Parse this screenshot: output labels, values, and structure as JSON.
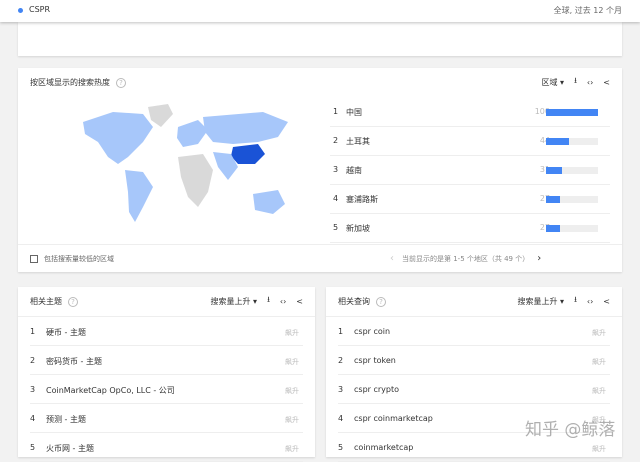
{
  "topbar": {
    "term": "CSPR",
    "scope": "全球, 过去 12 个月"
  },
  "region": {
    "title": "按区域显示的搜索热度",
    "help": "?",
    "dropdown": "区域 ▾",
    "download": "⭳",
    "embed": "‹›",
    "share": "<",
    "rows": [
      {
        "rank": "1",
        "name": "中国",
        "value": "100",
        "pct": 100
      },
      {
        "rank": "2",
        "name": "土耳其",
        "value": "44",
        "pct": 44
      },
      {
        "rank": "3",
        "name": "越南",
        "value": "31",
        "pct": 31
      },
      {
        "rank": "4",
        "name": "塞浦路斯",
        "value": "27",
        "pct": 27
      },
      {
        "rank": "5",
        "name": "新加坡",
        "value": "27",
        "pct": 27
      }
    ],
    "checkbox_label": "包括搜索量较低的区域",
    "pagination": "当前显示的是第 1-5 个地区（共 49 个）",
    "prev": "‹",
    "next": "›",
    "colors": {
      "accent": "#4285f4",
      "china": "#1a53d6",
      "mid": "#a7c7fa",
      "none": "#d9d9d9"
    }
  },
  "topics": {
    "title": "相关主题",
    "help": "?",
    "dropdown": "搜索量上升 ▾",
    "download": "⭳",
    "embed": "‹›",
    "share": "<",
    "rows": [
      {
        "rank": "1",
        "label": "硬币 - 主题",
        "value": "飙升"
      },
      {
        "rank": "2",
        "label": "密码货币 - 主题",
        "value": "飙升"
      },
      {
        "rank": "3",
        "label": "CoinMarketCap OpCo, LLC - 公司",
        "value": "飙升"
      },
      {
        "rank": "4",
        "label": "预测 - 主题",
        "value": "飙升"
      },
      {
        "rank": "5",
        "label": "火币网 - 主题",
        "value": "飙升"
      }
    ]
  },
  "queries": {
    "title": "相关查询",
    "help": "?",
    "dropdown": "搜索量上升 ▾",
    "download": "⭳",
    "embed": "‹›",
    "share": "<",
    "rows": [
      {
        "rank": "1",
        "label": "cspr coin",
        "value": "飙升"
      },
      {
        "rank": "2",
        "label": "cspr token",
        "value": "飙升"
      },
      {
        "rank": "3",
        "label": "cspr crypto",
        "value": "飙升"
      },
      {
        "rank": "4",
        "label": "cspr coinmarketcap",
        "value": "飙升"
      },
      {
        "rank": "5",
        "label": "coinmarketcap",
        "value": "飙升"
      }
    ]
  },
  "watermark": "知乎 @鲸落"
}
